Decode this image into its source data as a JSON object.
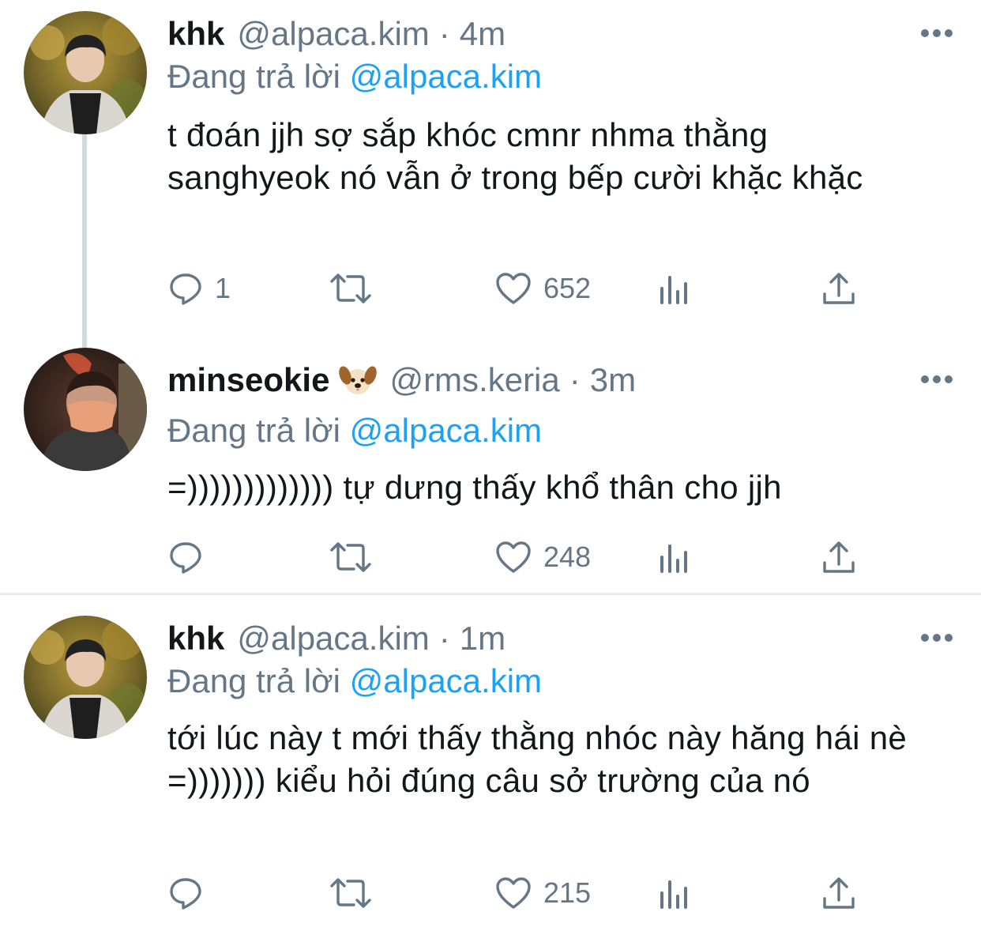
{
  "tweets": [
    {
      "name": "khk",
      "handle": "@alpaca.kim",
      "separator": "·",
      "time": "4m",
      "replying_prefix": "Đang trả lời",
      "replying_to": "@alpaca.kim",
      "text": "t đoán jjh sợ sắp khóc cmnr nhma thằng sanghyeok nó vẫn ở trong bếp cười khặc khặc",
      "reply_count": "1",
      "retweet_count": "",
      "like_count": "652"
    },
    {
      "name": "minseokie",
      "name_emoji": "dog-face-emoji",
      "handle": "@rms.keria",
      "separator": "·",
      "time": "3m",
      "replying_prefix": "Đang trả lời",
      "replying_to": "@alpaca.kim",
      "text": "=))))))))))))) tự dưng thấy khổ thân cho jjh",
      "reply_count": "",
      "retweet_count": "",
      "like_count": "248"
    },
    {
      "name": "khk",
      "handle": "@alpaca.kim",
      "separator": "·",
      "time": "1m",
      "replying_prefix": "Đang trả lời",
      "replying_to": "@alpaca.kim",
      "text": "tới lúc này t mới thấy thằng nhóc này hăng hái nè =))))))) kiểu hỏi đúng câu sở trường của nó",
      "reply_count": "",
      "retweet_count": "",
      "like_count": "215"
    }
  ],
  "icons": {
    "reply": "reply-icon",
    "retweet": "retweet-icon",
    "like": "heart-icon",
    "analytics": "analytics-icon",
    "share": "share-icon",
    "more": "more-icon"
  },
  "colors": {
    "text": "#14171a",
    "muted": "#657786",
    "link": "#1da1f2",
    "thread_line": "#cfd9de",
    "divider": "#e6ecf0"
  }
}
